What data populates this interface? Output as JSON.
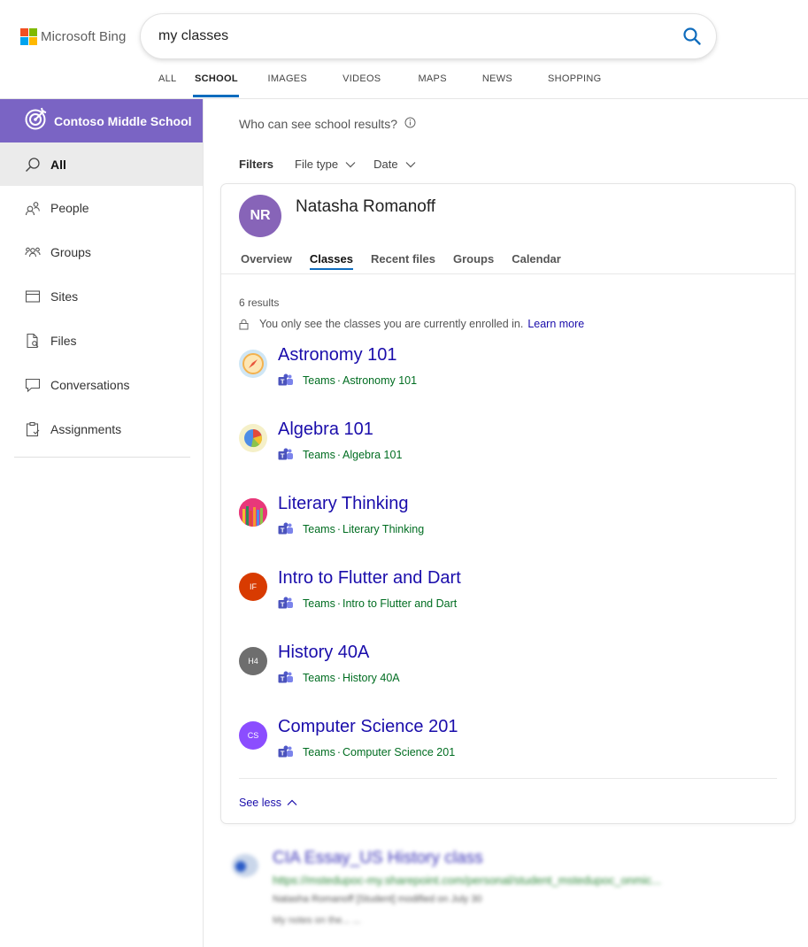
{
  "header": {
    "logo_text": "Microsoft Bing",
    "search_value": "my classes"
  },
  "nav": {
    "tabs": [
      "ALL",
      "SCHOOL",
      "IMAGES",
      "VIDEOS",
      "MAPS",
      "NEWS",
      "SHOPPING"
    ],
    "active": "SCHOOL"
  },
  "sidebar": {
    "school_name": "Contoso Middle School",
    "items": [
      {
        "label": "All",
        "icon": "search-icon",
        "active": true
      },
      {
        "label": "People",
        "icon": "people-icon"
      },
      {
        "label": "Groups",
        "icon": "groups-icon"
      },
      {
        "label": "Sites",
        "icon": "sites-icon"
      },
      {
        "label": "Files",
        "icon": "files-icon"
      },
      {
        "label": "Conversations",
        "icon": "conversations-icon"
      },
      {
        "label": "Assignments",
        "icon": "assignments-icon"
      }
    ]
  },
  "main": {
    "who_can_see": "Who can see school results?",
    "filters_label": "Filters",
    "filter_dropdowns": [
      "File type",
      "Date"
    ]
  },
  "person_card": {
    "initials": "NR",
    "name": "Natasha Romanoff",
    "avatar_color": "#8764b8",
    "tabs": [
      "Overview",
      "Classes",
      "Recent files",
      "Groups",
      "Calendar"
    ],
    "active_tab": "Classes",
    "results_count": "6 results",
    "enrolled_note": "You only see the classes you are currently enrolled in.",
    "learn_more": "Learn more",
    "classes": [
      {
        "title": "Astronomy 101",
        "source": "Teams",
        "path": "Astronomy 101",
        "icon": "astronomy-icon"
      },
      {
        "title": "Algebra 101",
        "source": "Teams",
        "path": "Algebra 101",
        "icon": "algebra-icon"
      },
      {
        "title": "Literary Thinking",
        "source": "Teams",
        "path": "Literary Thinking",
        "icon": "literary-icon"
      },
      {
        "title": "Intro to Flutter and Dart",
        "source": "Teams",
        "path": "Intro to Flutter and Dart",
        "initials": "IF",
        "color": "#d83b01"
      },
      {
        "title": "History 40A",
        "source": "Teams",
        "path": "History 40A",
        "initials": "H4",
        "color": "#6e6e6e"
      },
      {
        "title": "Computer Science 201",
        "source": "Teams",
        "path": "Computer Science 201",
        "initials": "CS",
        "color": "#8b4dff"
      }
    ],
    "see_less": "See less"
  },
  "blurred_result": {
    "title": "CIA Essay_US History class",
    "url": "https://mstedupoc-my.sharepoint.com/personal/student_mstedupoc_onmic...",
    "meta": "Natasha Romanoff [Student] modified on July 30",
    "snippet": "My notes on the... ..."
  },
  "colors": {
    "accent": "#0f6cbd",
    "link": "#1a0dab",
    "school_banner": "#7a64c4",
    "teams_purple": "#5059c9"
  }
}
